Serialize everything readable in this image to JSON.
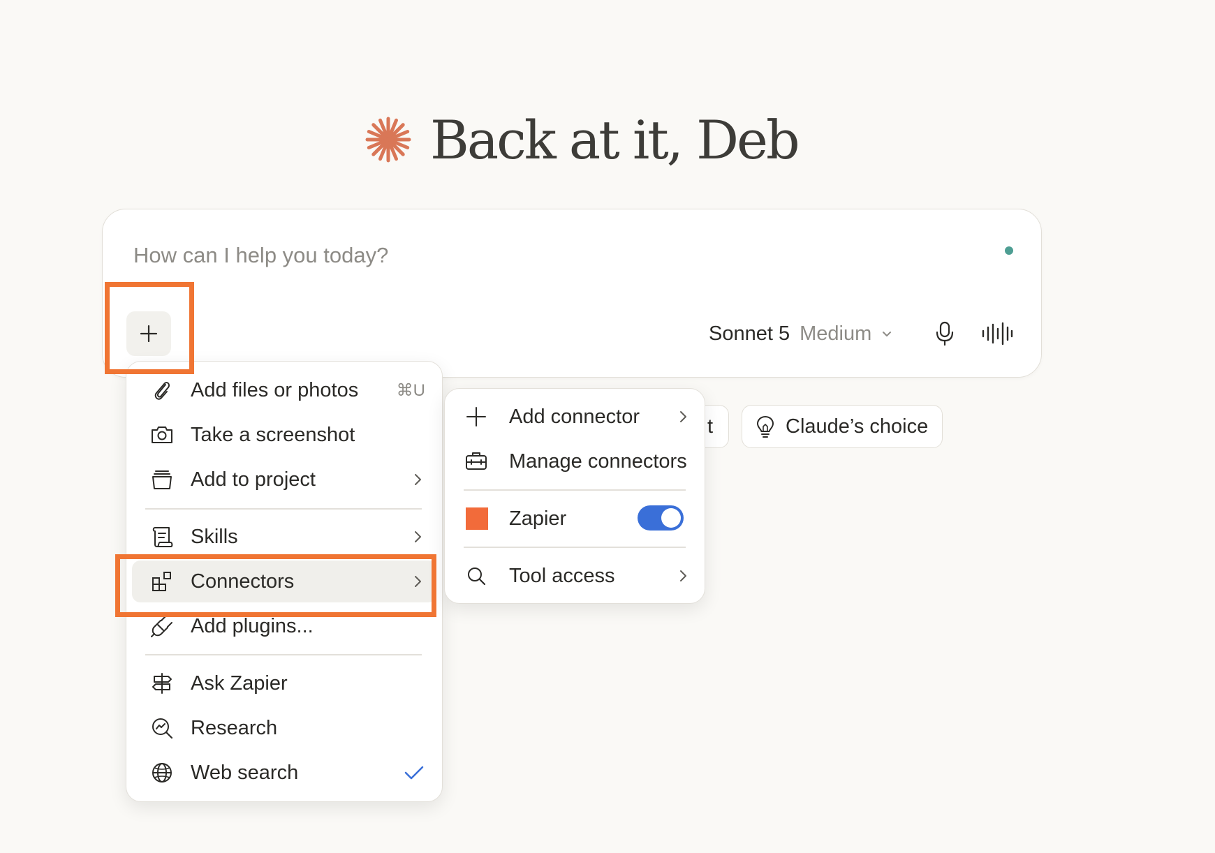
{
  "greeting": {
    "title": "Back at it, Deb",
    "logo_icon": "claude-starburst-icon",
    "logo_color": "#d97757"
  },
  "composer": {
    "placeholder": "How can I help you today?",
    "status_color": "#4e9e93",
    "plus_icon": "plus-icon",
    "model": {
      "name": "Sonnet 5",
      "effort": "Medium"
    },
    "mic_icon": "microphone-icon",
    "voice_icon": "voice-waveform-icon"
  },
  "suggestions": [
    {
      "label": "t"
    },
    {
      "label": "Claude’s choice",
      "icon": "lightbulb-icon"
    }
  ],
  "menu": {
    "items": [
      {
        "label": "Add files or photos",
        "icon": "paperclip-icon",
        "shortcut": "⌘U"
      },
      {
        "label": "Take a screenshot",
        "icon": "camera-icon"
      },
      {
        "label": "Add to project",
        "icon": "project-box-icon",
        "has_submenu": true
      },
      {
        "label": "Skills",
        "icon": "scroll-icon",
        "has_submenu": true
      },
      {
        "label": "Connectors",
        "icon": "connectors-icon",
        "has_submenu": true,
        "active": true
      },
      {
        "label": "Add plugins...",
        "icon": "plug-icon"
      },
      {
        "label": "Ask Zapier",
        "icon": "signpost-icon"
      },
      {
        "label": "Research",
        "icon": "research-icon"
      },
      {
        "label": "Web search",
        "icon": "globe-icon",
        "checked": true
      }
    ]
  },
  "submenu": {
    "items": [
      {
        "label": "Add connector",
        "icon": "plus-icon",
        "has_submenu": true
      },
      {
        "label": "Manage connectors",
        "icon": "toolbox-icon"
      },
      {
        "label": "Zapier",
        "icon": "zapier-icon",
        "icon_color": "#f26b3a",
        "toggle": true,
        "enabled": true
      },
      {
        "label": "Tool access",
        "icon": "search-icon",
        "has_submenu": true
      }
    ]
  },
  "colors": {
    "accent": "#f07533",
    "toggle_on": "#3a6fd8",
    "check": "#3a6fd8",
    "background": "#faf9f6"
  }
}
